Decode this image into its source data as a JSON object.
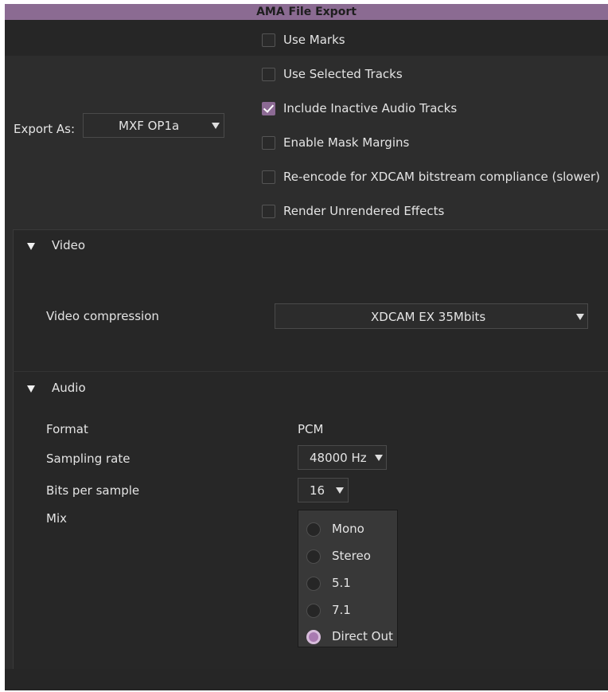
{
  "window": {
    "title": "AMA File Export"
  },
  "export_as": {
    "label": "Export As:",
    "value": "MXF OP1a"
  },
  "options": [
    {
      "label": "Use Marks",
      "checked": false
    },
    {
      "label": "Use Selected Tracks",
      "checked": false
    },
    {
      "label": "Include Inactive Audio Tracks",
      "checked": true
    },
    {
      "label": "Enable Mask Margins",
      "checked": false
    },
    {
      "label": "Re-encode for XDCAM bitstream compliance (slower)",
      "checked": false
    },
    {
      "label": "Render Unrendered Effects",
      "checked": false
    }
  ],
  "video": {
    "heading": "Video",
    "compression_label": "Video compression",
    "compression_value": "XDCAM EX 35Mbits"
  },
  "audio": {
    "heading": "Audio",
    "format_label": "Format",
    "format_value": "PCM",
    "sampling_label": "Sampling rate",
    "sampling_value": "48000 Hz",
    "bits_label": "Bits per sample",
    "bits_value": "16",
    "mix_label": "Mix",
    "mix_options": [
      "Mono",
      "Stereo",
      "5.1",
      "7.1",
      "Direct Out"
    ],
    "mix_selected": "Direct Out"
  },
  "colors": {
    "accent": "#8c6a94",
    "titlebar": "#8b6b92",
    "background": "#2d2d2d"
  }
}
